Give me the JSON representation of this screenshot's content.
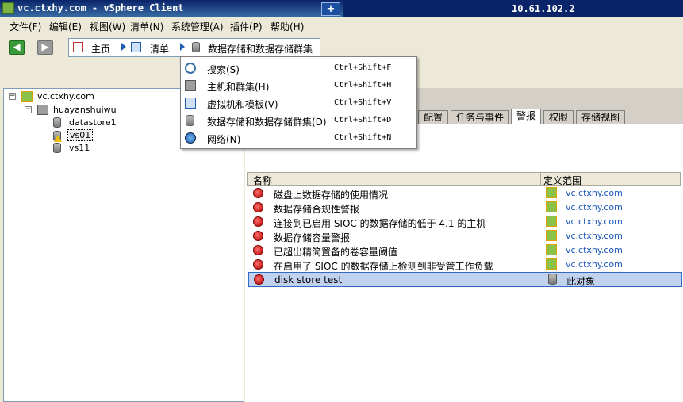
{
  "window": {
    "title": "vc.ctxhy.com - vSphere Client",
    "remote_host": "10.61.102.2",
    "pin_label": "+"
  },
  "menu": [
    "文件(F)",
    "编辑(E)",
    "视图(W)",
    "清单(N)",
    "系统管理(A)",
    "插件(P)",
    "帮助(H)"
  ],
  "nav": {
    "back": "◀",
    "forward": "▶",
    "crumbs": [
      "主页",
      "清单",
      "数据存储和数据存储群集"
    ]
  },
  "dropdown": [
    {
      "label": "搜索(S)",
      "shortcut": "Ctrl+Shift+F",
      "icon": "search-icon"
    },
    {
      "label": "主机和群集(H)",
      "shortcut": "Ctrl+Shift+H",
      "icon": "hosts-clusters-icon"
    },
    {
      "label": "虚拟机和模板(V)",
      "shortcut": "Ctrl+Shift+V",
      "icon": "vm-templates-icon"
    },
    {
      "label": "数据存储和数据存储群集(D)",
      "shortcut": "Ctrl+Shift+D",
      "icon": "datastore-icon"
    },
    {
      "label": "网络(N)",
      "shortcut": "Ctrl+Shift+N",
      "icon": "network-icon"
    }
  ],
  "tree": {
    "root": "vc.ctxhy.com",
    "datacenter": "huayanshuiwu",
    "datastores": [
      "datastore1",
      "vs01",
      "vs11"
    ]
  },
  "tabs": [
    "配置",
    "任务与事件",
    "警报",
    "权限",
    "存储视图"
  ],
  "active_tab": "警报",
  "grid": {
    "columns": [
      "名称",
      "定义范围"
    ],
    "rows": [
      {
        "name": "磁盘上数据存储的使用情况",
        "scope": "vc.ctxhy.com"
      },
      {
        "name": "数据存储合规性警报",
        "scope": "vc.ctxhy.com"
      },
      {
        "name": "连接到已启用 SIOC 的数据存储的低于 4.1 的主机",
        "scope": "vc.ctxhy.com"
      },
      {
        "name": "数据存储容量警报",
        "scope": "vc.ctxhy.com"
      },
      {
        "name": "已超出精简置备的卷容量阈值",
        "scope": "vc.ctxhy.com"
      },
      {
        "name": "在启用了 SIOC 的数据存储上检测到非受管工作负载",
        "scope": "vc.ctxhy.com"
      },
      {
        "name": "disk store test",
        "scope": "此对象"
      }
    ]
  },
  "colors": {
    "title_bar": "#0a246a",
    "selection": "#c1d2ee",
    "link": "#1a57b8"
  }
}
